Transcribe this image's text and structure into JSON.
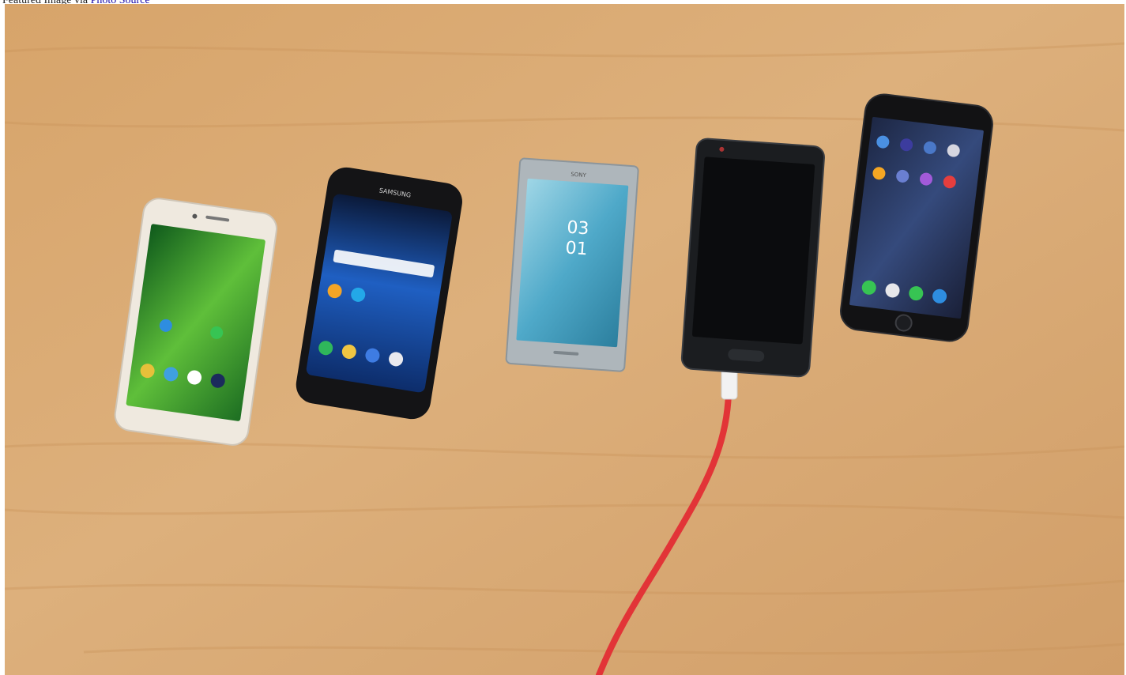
{
  "caption": {
    "prefix": "Featured Image via",
    "link_text": "Photo Source"
  },
  "photo": {
    "colors": {
      "table": "#d9aa72",
      "cable": "#e8373a",
      "huawei_body": "#ece6dc",
      "huawei_screen": "#3e9a35",
      "samsung_body": "#141416",
      "samsung_screen": "#1a4ea8",
      "sony_body": "#aab3b8",
      "sony_screen": "#4fa9c9",
      "oneplus_body": "#1a1c1f",
      "iphone_body": "#121214",
      "iphone_screen": "#2e3f6c"
    },
    "phones": {
      "samsung_brand": "SAMSUNG",
      "sony_brand": "SONY",
      "sony_clock_hour": "03",
      "sony_clock_min": "01"
    }
  }
}
